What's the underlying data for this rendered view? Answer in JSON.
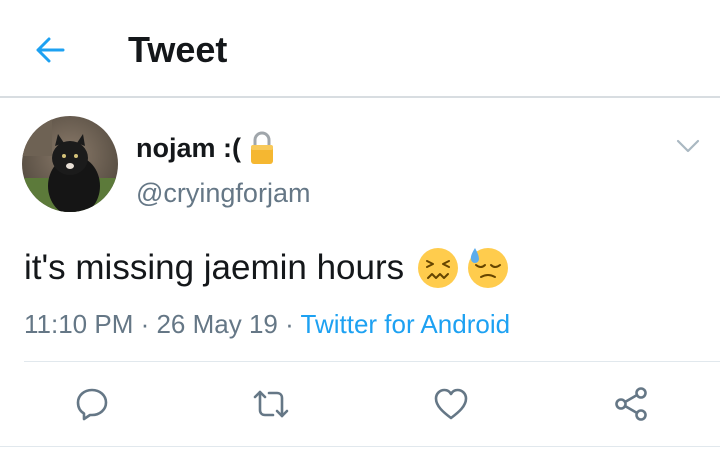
{
  "header": {
    "title": "Tweet",
    "back_icon": "arrow-left-icon"
  },
  "tweet": {
    "display_name": "nojam :(",
    "handle": "@cryingforjam",
    "protected_icon": "lock-icon",
    "text": "it's missing jaemin hours",
    "emojis": [
      "confounded-face-emoji",
      "downcast-face-with-sweat-emoji"
    ],
    "time": "11:10 PM",
    "separator": " · ",
    "date": "26 May 19",
    "source": "Twitter for Android"
  },
  "actions": {
    "reply_icon": "reply-icon",
    "retweet_icon": "retweet-icon",
    "like_icon": "heart-icon",
    "share_icon": "share-icon"
  },
  "colors": {
    "accent": "#1da1f2",
    "secondary_text": "#657786",
    "icon_gray": "#657786",
    "divider": "#e1e8ed",
    "lock": "#f5b731"
  }
}
